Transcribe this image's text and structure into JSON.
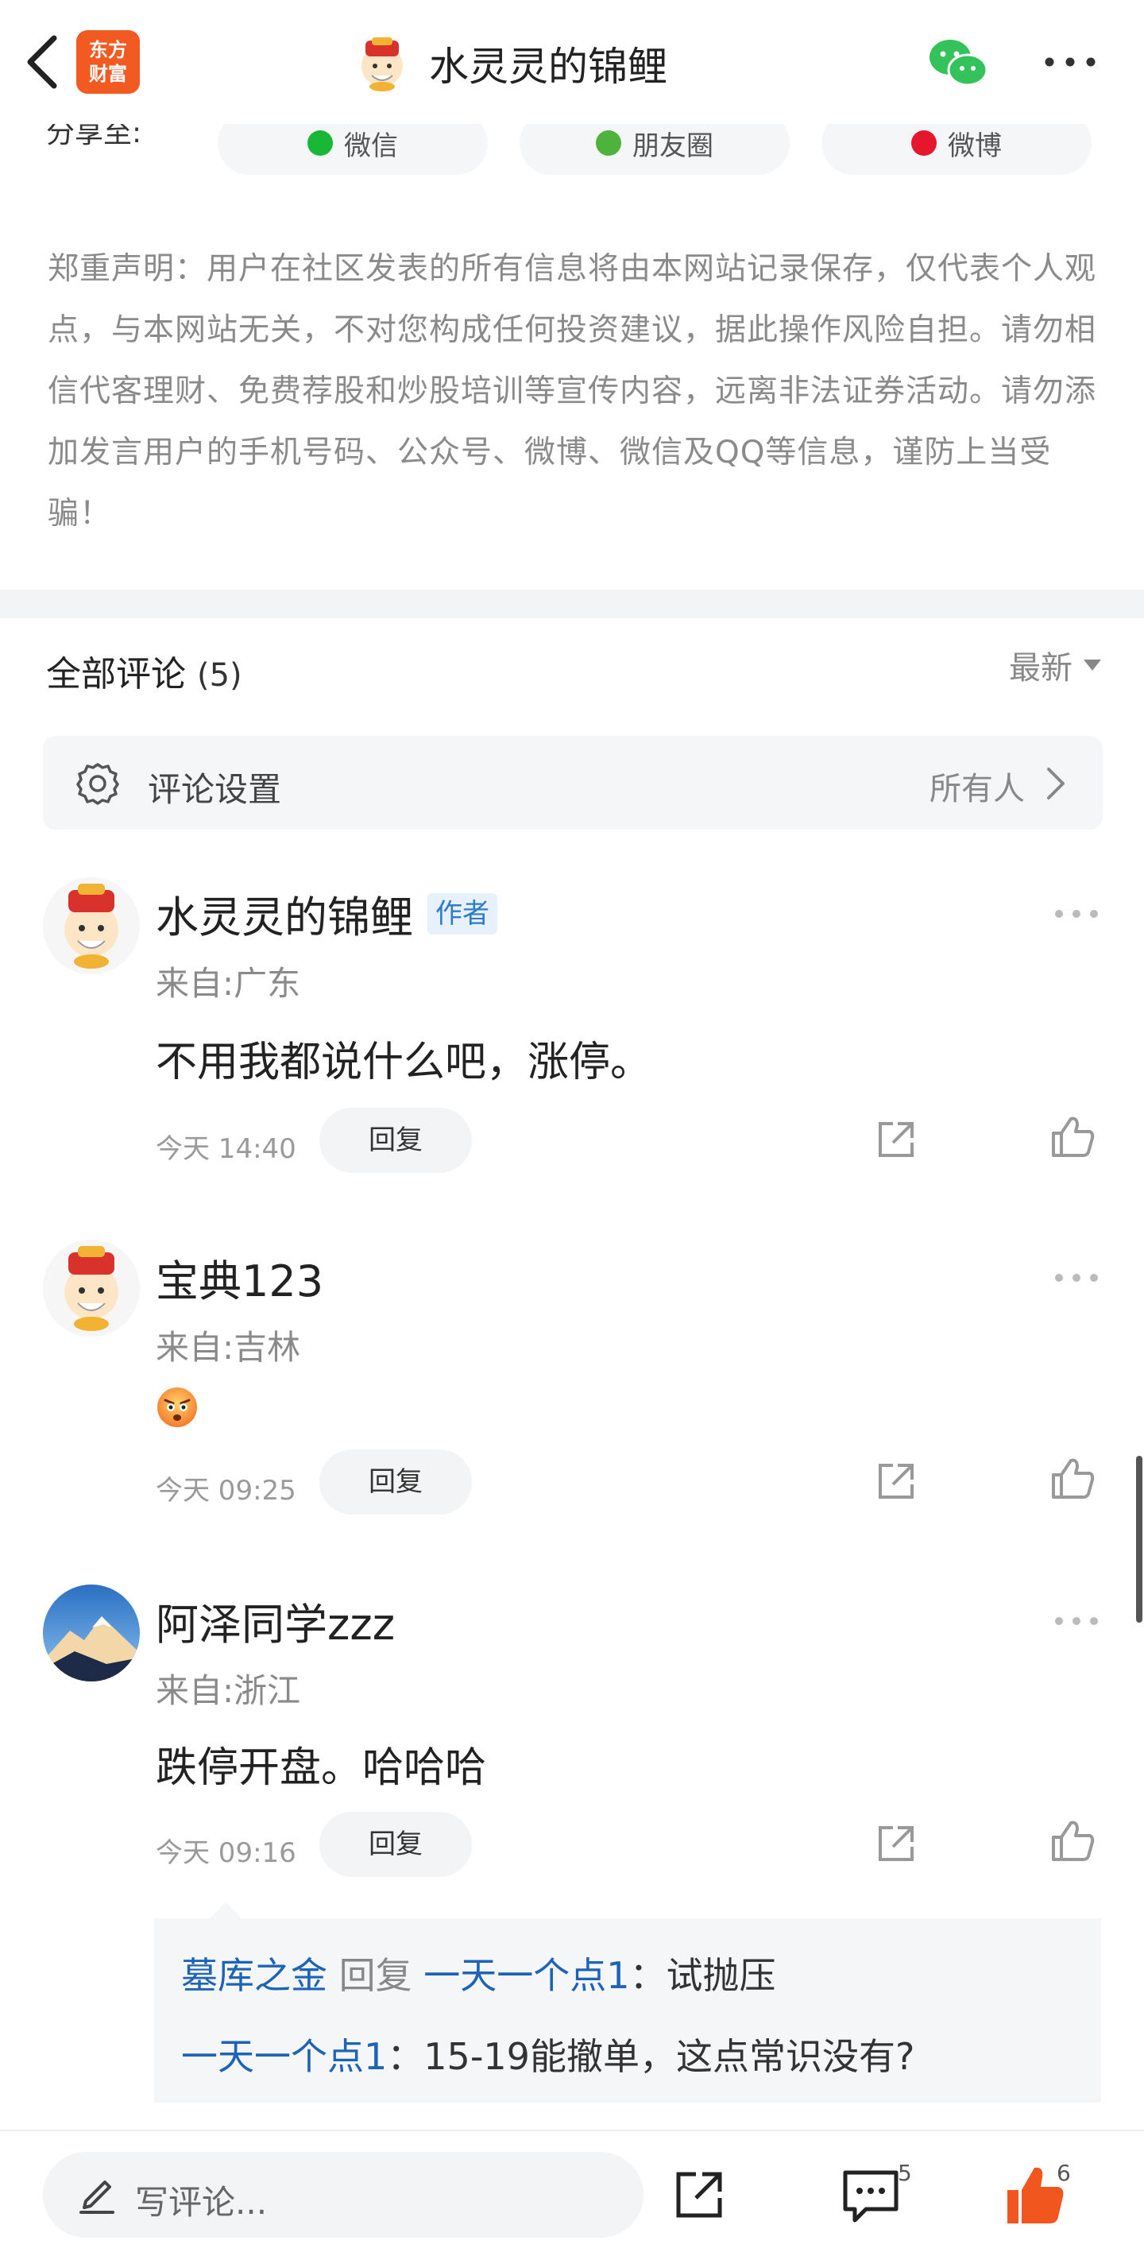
{
  "header": {
    "brand_logo_text": "东方财富",
    "title": "水灵灵的锦鲤"
  },
  "share": {
    "label": "分享至:",
    "buttons": [
      {
        "label": "微信",
        "color": "#18b736"
      },
      {
        "label": "朋友圈",
        "color": "#4db33d"
      },
      {
        "label": "微博",
        "color": "#e6162d"
      }
    ]
  },
  "disclaimer": {
    "text": "郑重声明：用户在社区发表的所有信息将由本网站记录保存，仅代表个人观点，与本网站无关，不对您构成任何投资建议，据此操作风险自担。请勿相信代客理财、免费荐股和炒股培训等宣传内容，远离非法证券活动。请勿添加发言用户的手机号码、公众号、微博、微信及QQ等信息，谨防上当受骗！"
  },
  "comments_section": {
    "title": "全部评论",
    "count": "(5)",
    "sort_label": "最新",
    "settings": {
      "label": "评论设置",
      "value": "所有人"
    },
    "items": [
      {
        "name": "水灵灵的锦鲤",
        "tag": "作者",
        "location": "来自:广东",
        "text": "不用我都说什么吧，涨停。",
        "time": "今天 14:40",
        "reply_label": "回复"
      },
      {
        "name": "宝典123",
        "location": "来自:吉林",
        "emoji": "angry-face-emoji",
        "time": "今天 09:25",
        "reply_label": "回复"
      },
      {
        "name": "阿泽同学zzz",
        "location": "来自:浙江",
        "text": "跌停开盘。哈哈哈",
        "time": "今天 09:16",
        "reply_label": "回复",
        "replies": [
          {
            "from": "墓库之金",
            "verb": "回复",
            "to": "一天一个点1",
            "text": "：试抛压"
          },
          {
            "from": "一天一个点1",
            "text": "：15-19能撤单，这点常识没有?"
          }
        ]
      }
    ]
  },
  "bottom_bar": {
    "placeholder": "写评论...",
    "comment_count": "5",
    "like_count": "6"
  },
  "colors": {
    "brand": "#f35a22",
    "link_blue": "#1d64b8",
    "like_orange": "#f0561e",
    "wechat_green": "#34c25a"
  }
}
